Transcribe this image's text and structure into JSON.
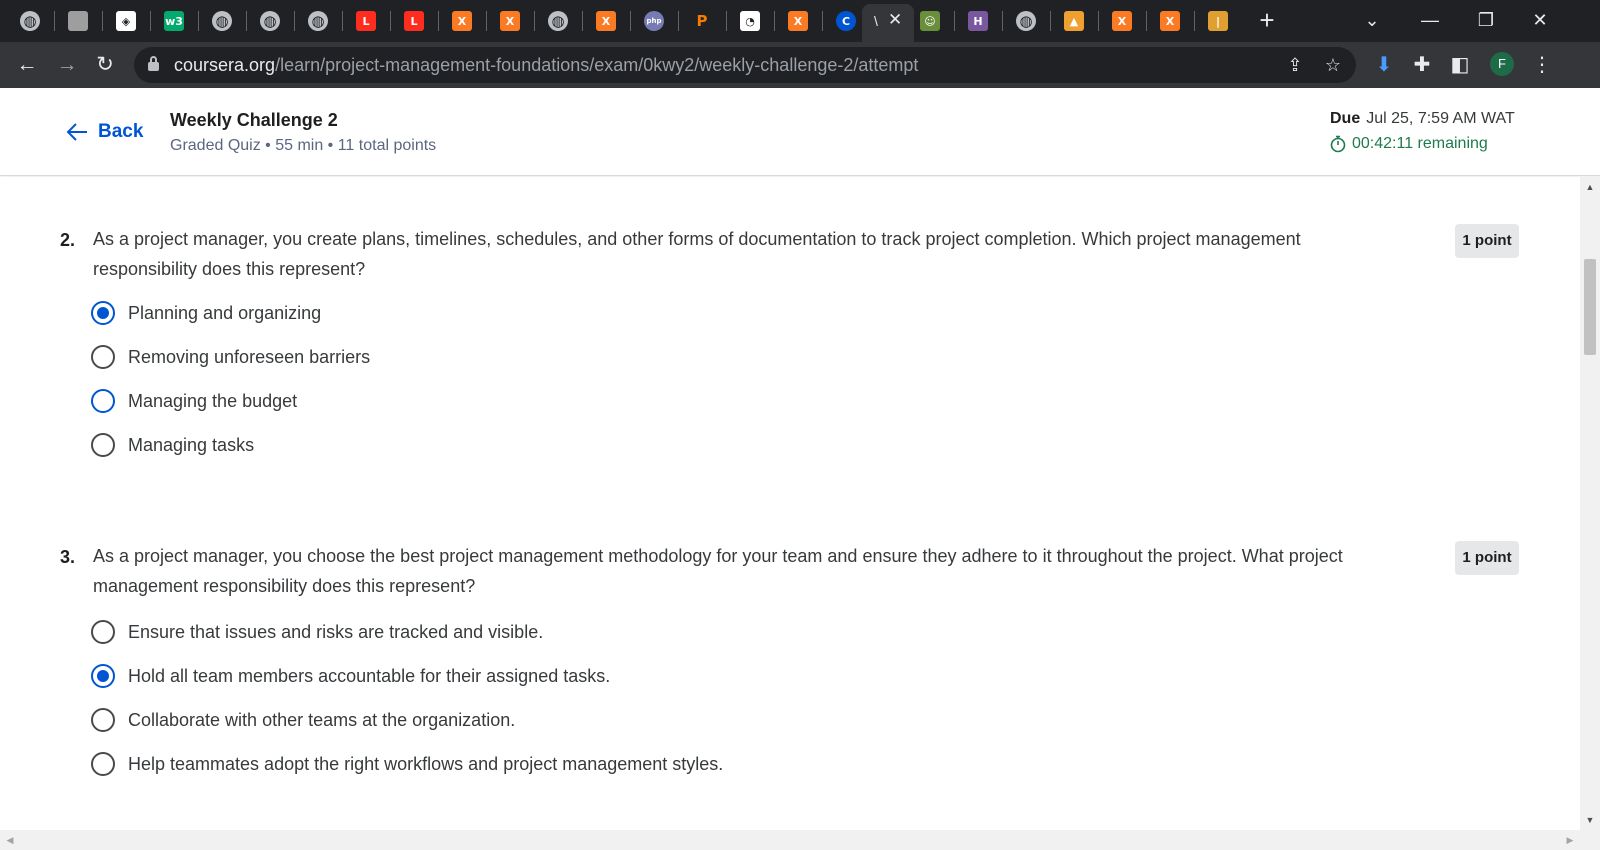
{
  "browser": {
    "tabs": [
      {
        "icon": "globe-icon",
        "letter": "",
        "color": "#bdc1c6"
      },
      {
        "icon": "moon-icon",
        "letter": "",
        "color": "#9e9e9e"
      },
      {
        "icon": "codepen-icon",
        "letter": "◈",
        "color": "#ffffff"
      },
      {
        "icon": "w3schools-icon",
        "letter": "w3",
        "color": "#04aa6d"
      },
      {
        "icon": "globe-icon",
        "letter": "",
        "color": "#bdc1c6"
      },
      {
        "icon": "globe-icon",
        "letter": "",
        "color": "#bdc1c6"
      },
      {
        "icon": "globe-icon",
        "letter": "",
        "color": "#bdc1c6"
      },
      {
        "icon": "laravel-icon",
        "letter": "L",
        "color": "#ff2d20"
      },
      {
        "icon": "laravel-icon",
        "letter": "L",
        "color": "#ff2d20"
      },
      {
        "icon": "xampp-icon",
        "letter": "X",
        "color": "#fb7a24"
      },
      {
        "icon": "xampp-icon",
        "letter": "X",
        "color": "#fb7a24"
      },
      {
        "icon": "globe-icon",
        "letter": "",
        "color": "#bdc1c6"
      },
      {
        "icon": "xampp-icon",
        "letter": "X",
        "color": "#fb7a24"
      },
      {
        "icon": "php-icon",
        "letter": "php",
        "color": "#777bb3"
      },
      {
        "icon": "p-icon",
        "letter": "P",
        "color": "#202124"
      },
      {
        "icon": "chart-icon",
        "letter": "◔",
        "color": "#ffffff"
      },
      {
        "icon": "xampp-icon",
        "letter": "X",
        "color": "#fb7a24"
      },
      {
        "icon": "coursera-icon",
        "letter": "C",
        "color": "#0056d2"
      }
    ],
    "active_tab": {
      "label": "\\",
      "close": "✕"
    },
    "tabs_after": [
      {
        "icon": "avatar-icon",
        "letter": "☺",
        "color": "#6a8f3c"
      },
      {
        "icon": "heroku-icon",
        "letter": "H",
        "color": "#79589f"
      },
      {
        "icon": "globe-icon",
        "letter": "",
        "color": "#bdc1c6"
      },
      {
        "icon": "mountain-icon",
        "letter": "▲",
        "color": "#f0a030"
      },
      {
        "icon": "xampp-icon",
        "letter": "X",
        "color": "#fb7a24"
      },
      {
        "icon": "xampp-icon",
        "letter": "X",
        "color": "#fb7a24"
      },
      {
        "icon": "bars-icon",
        "letter": "|",
        "color": "#e0a030"
      }
    ],
    "url_host": "coursera.org",
    "url_path": "/learn/project-management-foundations/exam/0kwy2/weekly-challenge-2/attempt",
    "profile_initial": "F"
  },
  "header": {
    "back_label": "Back",
    "title": "Weekly Challenge 2",
    "subtitle": "Graded Quiz • 55 min • 11 total points",
    "due_label": "Due",
    "due_value": "Jul 25, 7:59 AM WAT",
    "timer": "00:42:11 remaining"
  },
  "questions": [
    {
      "number": "2.",
      "text": "As a project manager, you create plans, timelines, schedules, and other forms of documentation to track project completion. Which project management responsibility does this represent?",
      "points": "1 point",
      "options": [
        {
          "label": "Planning and organizing",
          "selected": true
        },
        {
          "label": "Removing unforeseen barriers",
          "selected": false
        },
        {
          "label": "Managing the budget",
          "selected": false
        },
        {
          "label": "Managing tasks",
          "selected": false
        }
      ]
    },
    {
      "number": "3.",
      "text": "As a project manager, you choose the best project management methodology for your team and ensure they adhere to it throughout the project. What project management responsibility does this represent?",
      "points": "1 point",
      "options": [
        {
          "label": "Ensure that issues and risks are tracked and visible.",
          "selected": false
        },
        {
          "label": "Hold all team members accountable for their assigned tasks.",
          "selected": true
        },
        {
          "label": "Collaborate with other teams at the organization.",
          "selected": false
        },
        {
          "label": "Help teammates adopt the right workflows and project management styles.",
          "selected": false
        }
      ]
    }
  ]
}
